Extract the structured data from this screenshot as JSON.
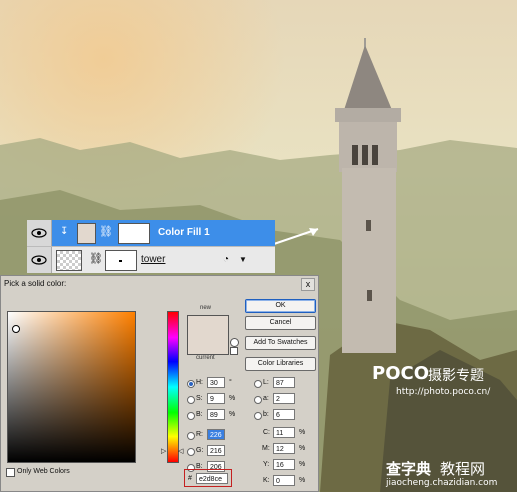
{
  "layers": [
    {
      "name": "Color Fill 1",
      "selected": true
    },
    {
      "name": "tower",
      "selected": false
    }
  ],
  "dialog": {
    "title": "Pick a solid color:",
    "close": "x",
    "new_label": "new",
    "current_label": "current",
    "new_color": "#e2d8ce",
    "current_color": "#e2d8ce",
    "buttons": {
      "ok": "OK",
      "cancel": "Cancel",
      "add_swatches": "Add To Swatches",
      "libraries": "Color Libraries"
    },
    "only_web": "Only Web Colors",
    "hsb": [
      {
        "lbl": "H:",
        "val": "30",
        "unit": "°",
        "on": true
      },
      {
        "lbl": "S:",
        "val": "9",
        "unit": "%"
      },
      {
        "lbl": "B:",
        "val": "89",
        "unit": "%"
      }
    ],
    "rgb": [
      {
        "lbl": "R:",
        "val": "226"
      },
      {
        "lbl": "G:",
        "val": "216"
      },
      {
        "lbl": "B:",
        "val": "206"
      }
    ],
    "lab": [
      {
        "lbl": "L:",
        "val": "87"
      },
      {
        "lbl": "a:",
        "val": "2"
      },
      {
        "lbl": "b:",
        "val": "6"
      }
    ],
    "cmyk": [
      {
        "lbl": "C:",
        "val": "11",
        "unit": "%"
      },
      {
        "lbl": "M:",
        "val": "12",
        "unit": "%"
      },
      {
        "lbl": "Y:",
        "val": "16",
        "unit": "%"
      },
      {
        "lbl": "K:",
        "val": "0",
        "unit": "%"
      }
    ],
    "hex_prefix": "#",
    "hex": "e2d8ce"
  },
  "watermark": {
    "brand": "POCO",
    "brand_cn": "摄影专题",
    "url": "http://photo.poco.cn/",
    "site_cn": "查字典",
    "site_cn2": "教程网",
    "site_url": "jiaocheng.chazidian.com"
  }
}
